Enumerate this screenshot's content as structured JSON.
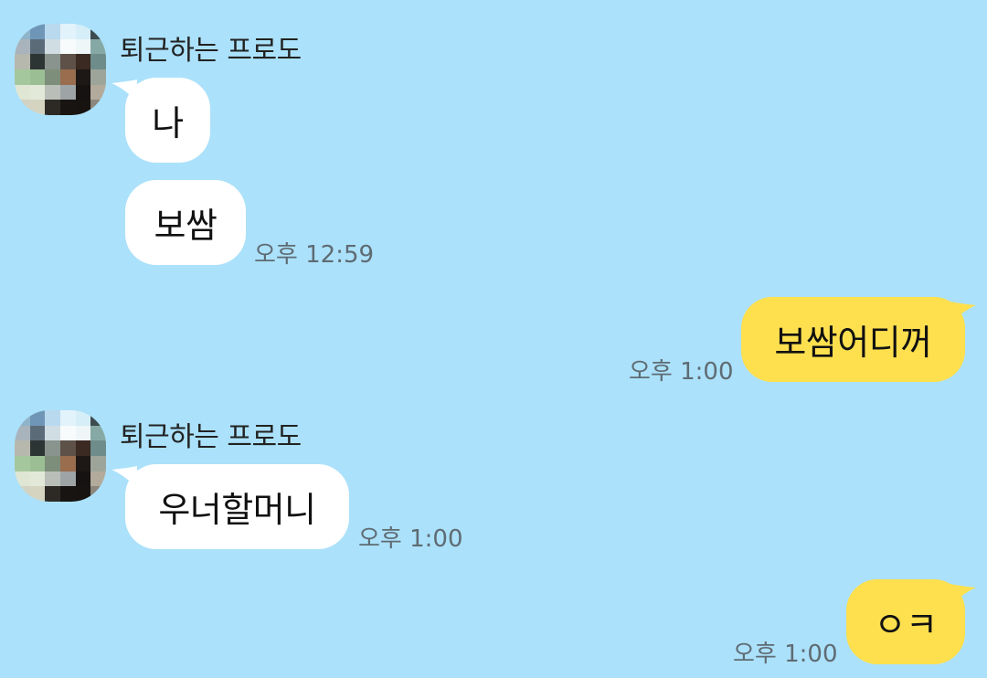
{
  "chat": {
    "groups": [
      {
        "sender": "퇴근하는 프로도",
        "messages": [
          {
            "text": "나",
            "time": ""
          },
          {
            "text": "보쌈",
            "time": "오후 12:59"
          }
        ]
      },
      {
        "me": true,
        "messages": [
          {
            "text": "보쌈어디꺼",
            "time": "오후 1:00"
          }
        ]
      },
      {
        "sender": "퇴근하는 프로도",
        "messages": [
          {
            "text": "우너할머니",
            "time": "오후 1:00"
          }
        ]
      },
      {
        "me": true,
        "messages": [
          {
            "text": "ㅇㅋ",
            "time": "오후 1:00"
          }
        ]
      }
    ]
  },
  "colors": {
    "background": "#abe1fa",
    "incoming_bubble": "#ffffff",
    "outgoing_bubble": "#fee04f"
  }
}
